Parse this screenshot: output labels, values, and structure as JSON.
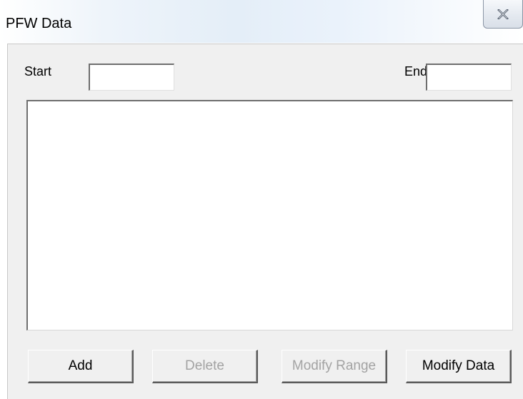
{
  "window": {
    "title": "PFW Data",
    "close_icon": "close-icon"
  },
  "range": {
    "start_label": "Start",
    "start_value": "",
    "end_label": "End",
    "end_value": ""
  },
  "data_list": {
    "items": []
  },
  "buttons": {
    "add": "Add",
    "delete": "Delete",
    "modify_range": "Modify Range",
    "modify_data": "Modify Data"
  }
}
